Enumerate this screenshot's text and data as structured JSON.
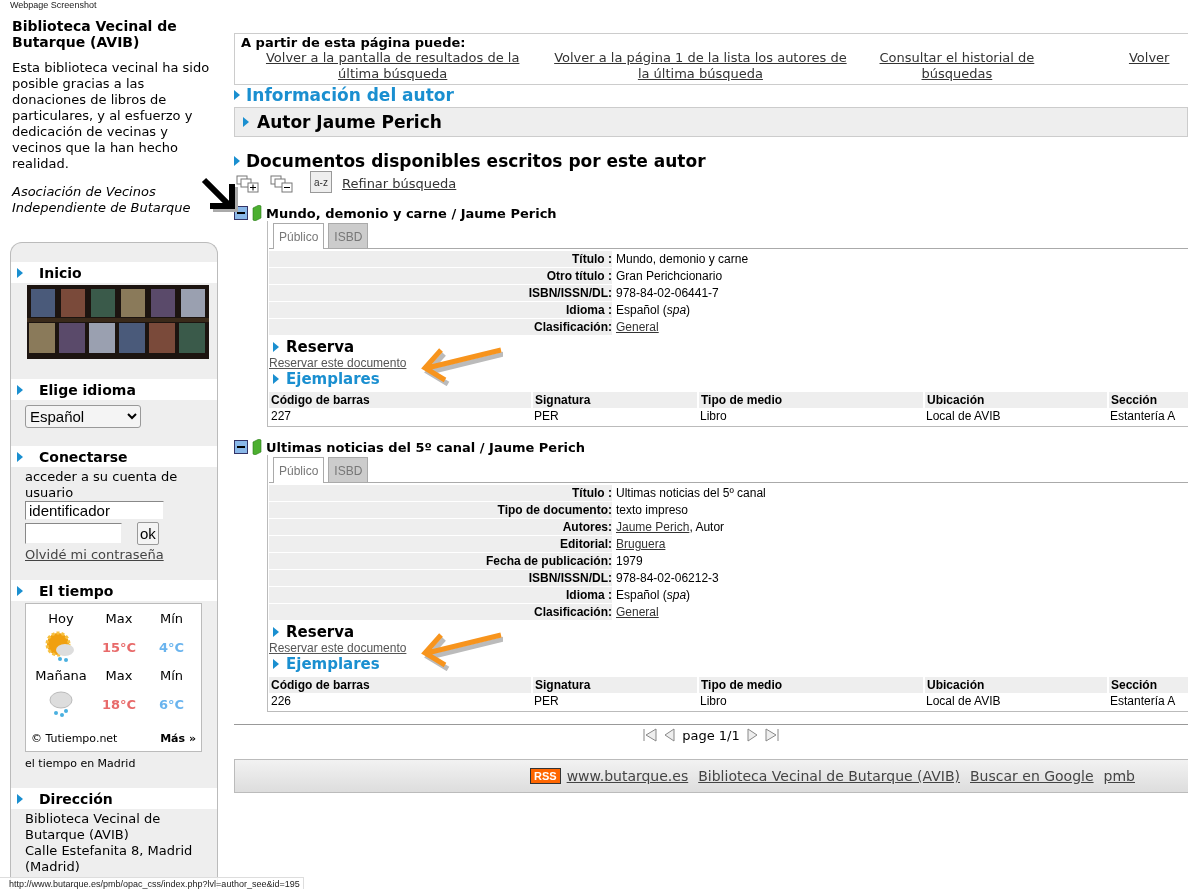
{
  "caption": "Webpage Screenshot",
  "sidebar": {
    "title": "Biblioteca Vecinal de Butarque (AVIB)",
    "intro": "Esta biblioteca vecinal ha sido posible gracias a las donaciones de libros de particulares, y al esfuerzo y dedicación de vecinas y vecinos que la han hecho realidad.",
    "association": "Asociación de Vecinos Independiente de Butarque",
    "sections": [
      {
        "kind": "banner",
        "heading": "Inicio"
      },
      {
        "kind": "language",
        "heading": "Elige idioma",
        "value": "Español"
      },
      {
        "kind": "login",
        "heading": "Conectarse",
        "prompt": "acceder a su cuenta de usuario",
        "username": "identificador",
        "button": "ok",
        "link": "Olvidé mi contraseña"
      },
      {
        "kind": "weather",
        "heading": "El tiempo",
        "rows": [
          {
            "day": "Hoy",
            "max_label": "Max",
            "min_label": "Mín",
            "max": "15°C",
            "min": "4°C",
            "kind": "sun_rain"
          },
          {
            "day": "Mañana",
            "max_label": "Max",
            "min_label": "Mín",
            "max": "18°C",
            "min": "6°C",
            "kind": "rain"
          }
        ],
        "credit": "© Tutiempo.net",
        "more": "Más »",
        "caption": "el tiempo en Madrid"
      },
      {
        "kind": "address",
        "heading": "Dirección",
        "lines": [
          "Biblioteca Vecinal de Butarque (AVIB)",
          "Calle Estefanita 8, Madrid (Madrid)"
        ]
      }
    ]
  },
  "nav": {
    "title": "A partir de esta página puede:",
    "links": [
      "Volver a la pantalla de resultados de la última búsqueda",
      "Volver a la página 1 de la lista los autores de la última búsqueda",
      "Consultar el historial de búsquedas",
      "Volver"
    ]
  },
  "author_heading": "Información del autor",
  "author": "Autor Jaume Perich",
  "documents_heading": "Documentos disponibles escritos por este autor",
  "sort_icon_text": "a-z",
  "refine": "Refinar búsqueda",
  "records": [
    {
      "title": "Mundo, demonio y carne / Jaume Perich",
      "expanded": true,
      "tabs": [
        {
          "label": "Público",
          "selected": true
        },
        {
          "label": "ISBD",
          "selected": false
        }
      ],
      "fields": [
        {
          "label": "Título :",
          "value": "Mundo, demonio y carne"
        },
        {
          "label": "Otro título :",
          "value": "Gran Perichcionario"
        },
        {
          "label": "ISBN/ISSN/DL:",
          "value": "978-84-02-06441-7"
        },
        {
          "label": "Idioma :",
          "value": "Español (*spa*)"
        },
        {
          "label": "Clasificación:",
          "link": "General"
        }
      ],
      "reserve_heading": "Reserva",
      "reserve_link": "Reservar este documento",
      "copies_heading": "Ejemplares",
      "columns": [
        "Código de barras",
        "Signatura",
        "Tipo de medio",
        "Ubicación",
        "Sección"
      ],
      "rows": [
        [
          "227",
          "PER",
          "Libro",
          "Local de AVIB",
          "Estantería A"
        ]
      ]
    },
    {
      "title": "Ultimas noticias del 5º canal / Jaume Perich",
      "expanded": true,
      "tabs": [
        {
          "label": "Público",
          "selected": true
        },
        {
          "label": "ISBD",
          "selected": false
        }
      ],
      "fields": [
        {
          "label": "Título :",
          "value": "Ultimas noticias del 5º canal"
        },
        {
          "label": "Tipo de documento:",
          "value": "texto impreso"
        },
        {
          "label": "Autores:",
          "link": "Jaume Perich",
          "value": ", Autor"
        },
        {
          "label": "Editorial:",
          "link": "Bruguera"
        },
        {
          "label": "Fecha de publicación:",
          "value": "1979"
        },
        {
          "label": "ISBN/ISSN/DL:",
          "value": "978-84-02-06212-3"
        },
        {
          "label": "Idioma :",
          "value": "Español (*spa*)"
        },
        {
          "label": "Clasificación:",
          "link": "General"
        }
      ],
      "reserve_heading": "Reserva",
      "reserve_link": "Reservar este documento",
      "copies_heading": "Ejemplares",
      "columns": [
        "Código de barras",
        "Signatura",
        "Tipo de medio",
        "Ubicación",
        "Sección"
      ],
      "rows": [
        [
          "226",
          "PER",
          "Libro",
          "Local de AVIB",
          "Estantería A"
        ]
      ]
    }
  ],
  "pager": "page 1/1",
  "footer": {
    "rss": "RSS",
    "links": [
      "www.butarque.es",
      "Biblioteca Vecinal de Butarque (AVIB)",
      "Buscar en Google",
      "pmb"
    ]
  },
  "status_url": "http://www.butarque.es/pmb/opac_css/index.php?lvl=author_see&id=195"
}
